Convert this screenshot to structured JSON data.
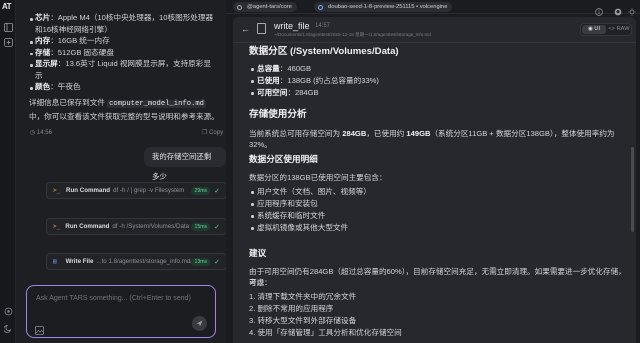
{
  "rail": {
    "logo": "AT"
  },
  "chat": {
    "specs": [
      {
        "label": "芯片",
        "value": "Apple M4（10核中央处理器，10核图形处理器",
        "value2": "和16核神经网络引擎）"
      },
      {
        "label": "内存",
        "value": "16GB 统一内存"
      },
      {
        "label": "存储",
        "value": "512GB 固态硬盘"
      },
      {
        "label": "显示屏",
        "value": "13.6英寸 Liquid 视网膜显示屏，支持原彩显",
        "value2": "示"
      },
      {
        "label": "颜色",
        "value": "午夜色"
      }
    ],
    "saved_prefix": "详细信息已保存到文件",
    "saved_file": "computer_model_info.md",
    "saved_suffix": "中，你可以查看该文件获取完整的型号说明和参考来源。",
    "msg_time": "14:56",
    "copy_label": "Copy",
    "user_message": "我的存储空间还剩多少",
    "tools": [
      {
        "icon": ">_",
        "name": "Run Command",
        "arg": "df -h / | grep -v Filesystem",
        "duration": "29ms"
      },
      {
        "icon": ">_",
        "name": "Run Command",
        "arg": "df -h /System/Volumes/Data |...",
        "duration": "15ms"
      },
      {
        "icon": "▤",
        "name": "Write File",
        "arg": "...to 1.8/agenttest/storage_info.md/~",
        "duration": "13ms"
      }
    ],
    "input_placeholder": "Ask Agent TARS something... (Ctrl+Enter to send)"
  },
  "topbar": {
    "repo": "@agent-tars/core",
    "model": "doubao-seed-1-8-preview-251115 • volcengine"
  },
  "file": {
    "name": "write_file",
    "time": "14:57",
    "path": "~/Documents/1.8/agenttest/2025-12-15 星期一/1.8/agenttest/storage_info.md",
    "view_ui": "UI",
    "view_raw": "RAW"
  },
  "doc": {
    "h_partition": "数据分区 (/System/Volumes/Data)",
    "partition_items": [
      {
        "label": "总容量",
        "value": "460GB"
      },
      {
        "label": "已使用",
        "value": "138GB (约占总容量的33%)"
      },
      {
        "label": "可用空间",
        "value": "284GB"
      }
    ],
    "h_analysis": "存储使用分析",
    "analysis_p1": "当前系统总可用存储空间为",
    "analysis_v1": "284GB",
    "analysis_p2": "，已使用约",
    "analysis_v2": "149GB",
    "analysis_p3": "（系统分区11GB + 数据分区138GB），整体使用率约为32%。",
    "h_detail": "数据分区使用明细",
    "detail_intro": "数据分区的138GB已使用空间主要包含：",
    "detail_items": [
      "用户文件（文档、图片、视频等）",
      "应用程序和安装包",
      "系统缓存和临时文件",
      "虚拟机镜像或其他大型文件"
    ],
    "h_advice": "建议",
    "advice_p": "由于可用空间仍有284GB（超过总容量的60%），目前存储空间充足，无需立即清理。如果需要进一步优化存储，可以",
    "advice_p2": "考虑：",
    "advice_items": [
      "1. 清理下载文件夹中的冗余文件",
      "2. 删除不常用的应用程序",
      "3. 转移大型文件到外部存储设备",
      "4. 使用「存储管理」工具分析和优化存储空间"
    ]
  }
}
